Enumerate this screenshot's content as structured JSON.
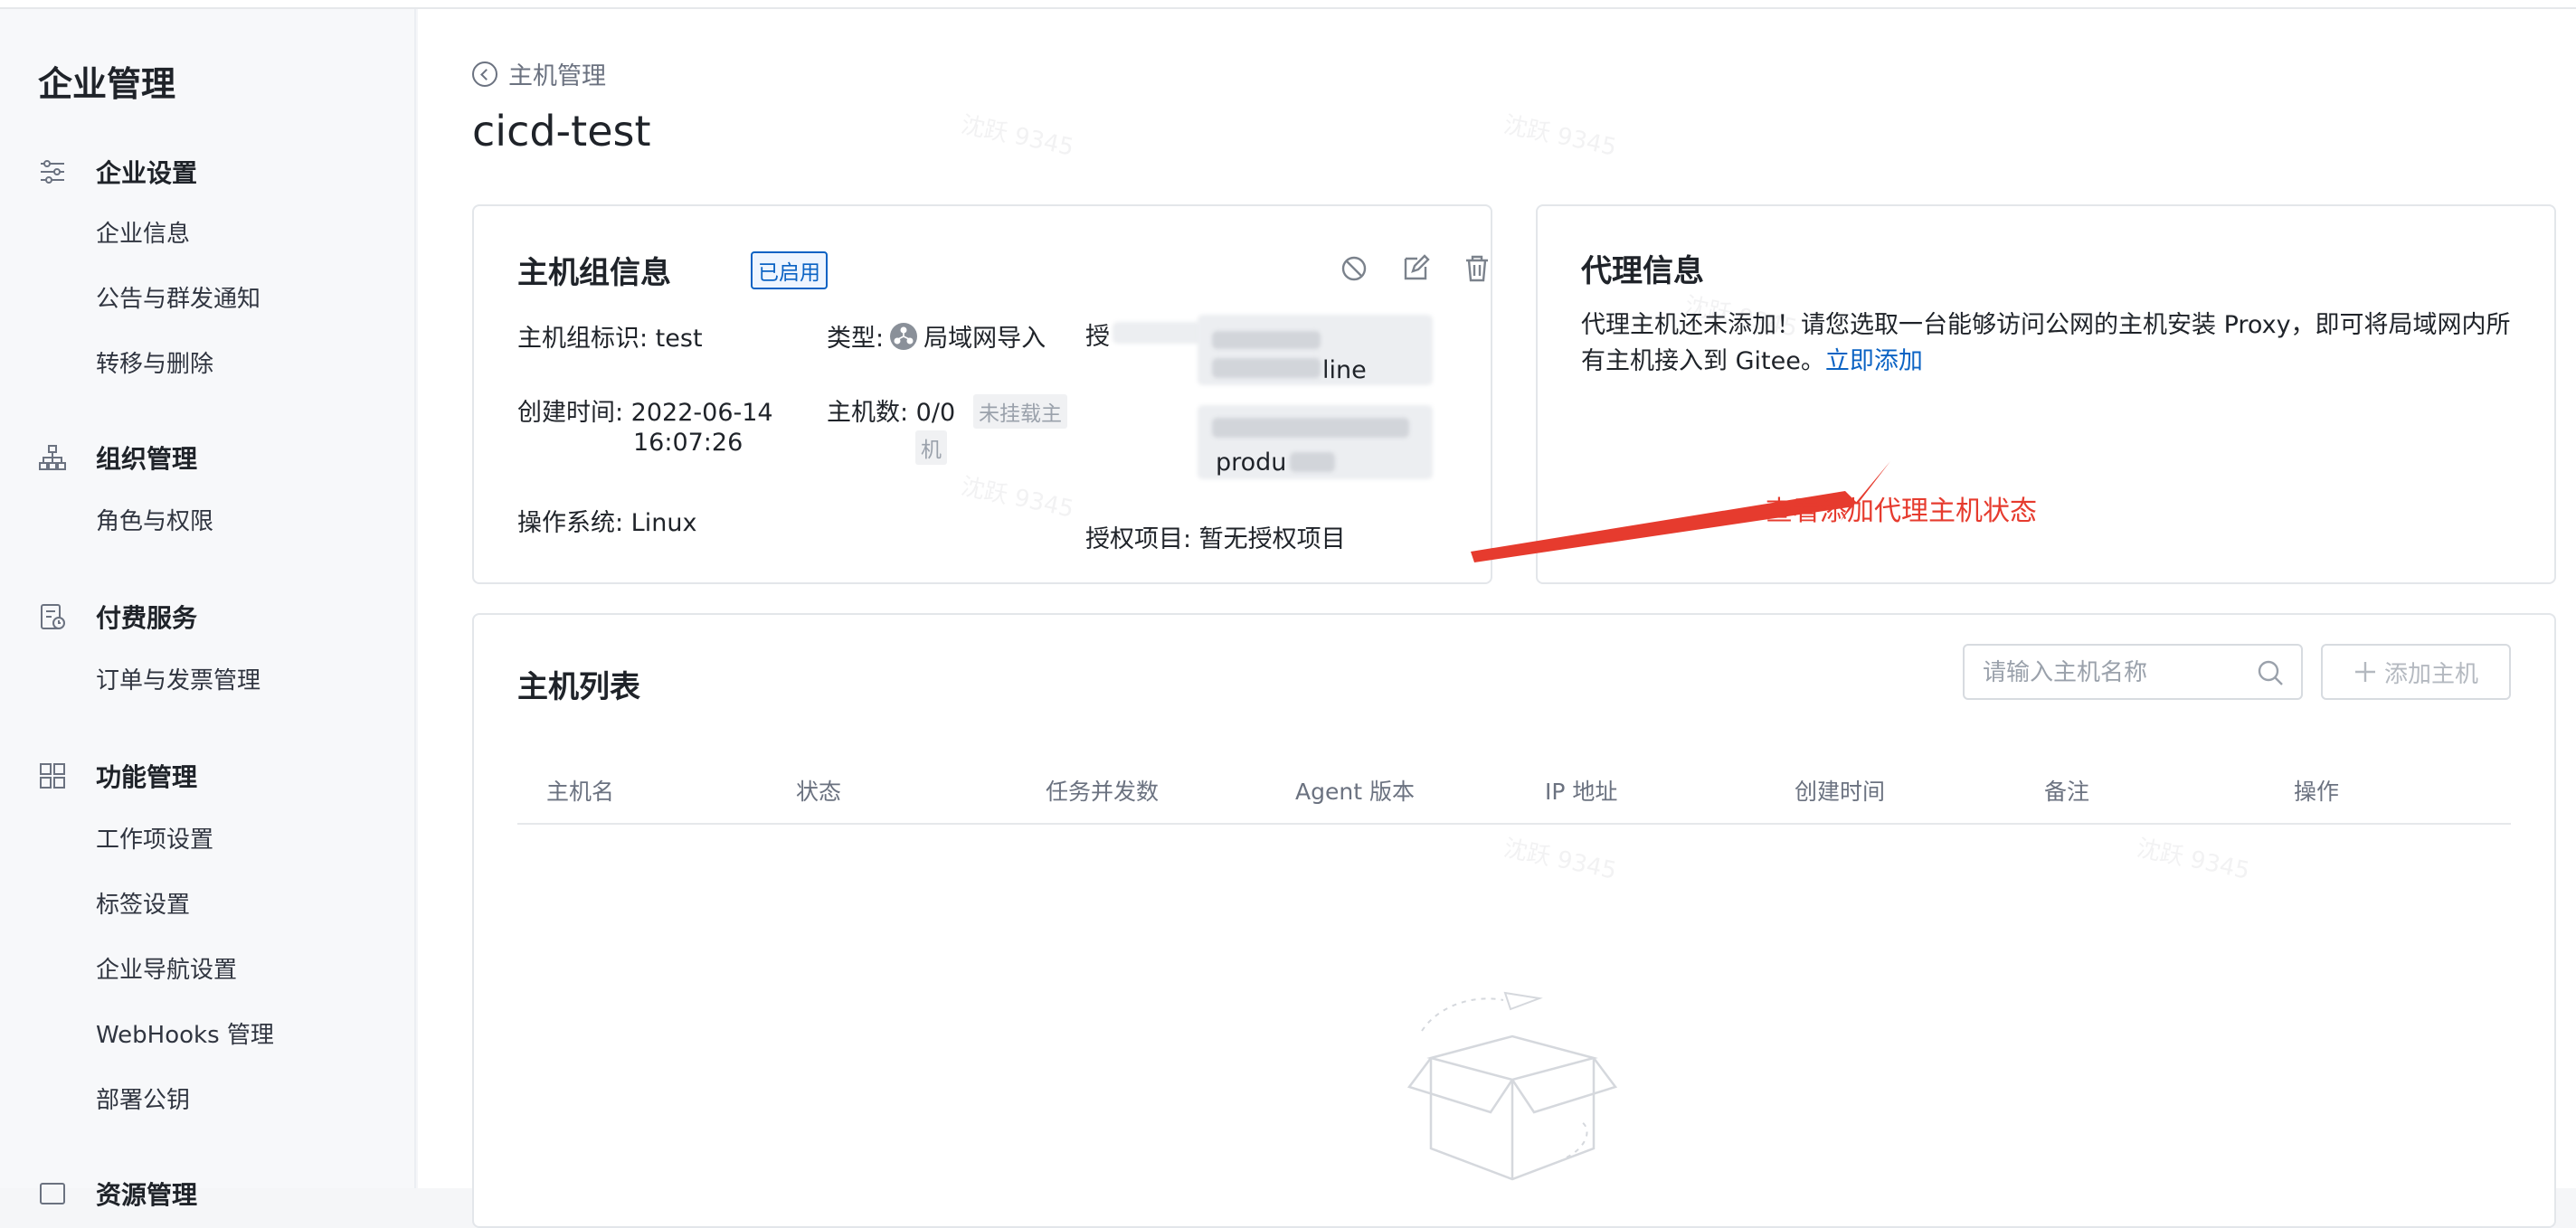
{
  "sidebar": {
    "title": "企业管理",
    "groups": [
      {
        "label": "企业设置",
        "icon": "sliders-icon",
        "items": [
          "企业信息",
          "公告与群发通知",
          "转移与删除"
        ]
      },
      {
        "label": "组织管理",
        "icon": "org-tree-icon",
        "items": [
          "角色与权限"
        ]
      },
      {
        "label": "付费服务",
        "icon": "billing-icon",
        "items": [
          "订单与发票管理"
        ]
      },
      {
        "label": "功能管理",
        "icon": "grid-icon",
        "items": [
          "工作项设置",
          "标签设置",
          "企业导航设置",
          "WebHooks 管理",
          "部署公钥"
        ]
      },
      {
        "label": "资源管理",
        "icon": "resource-icon",
        "items": []
      }
    ]
  },
  "header": {
    "back_label": "主机管理",
    "title": "cicd-test"
  },
  "host_group": {
    "title": "主机组信息",
    "status_badge": "已启用",
    "identifier": "主机组标识: test",
    "created_label": "创建时间: 2022-06-14",
    "created_time": "16:07:26",
    "os": "操作系统: Linux",
    "type_label": "类型:",
    "type_value": "局域网导入",
    "host_count": "主机数: 0/0",
    "unmounted_tag_1": "未挂载主",
    "unmounted_tag_2": "机",
    "auth_label_partial": "授",
    "blur_text_1": "line",
    "blur_text_2": "produ",
    "auth_projects": "授权项目: 暂无授权项目"
  },
  "proxy": {
    "title": "代理信息",
    "message": "代理主机还未添加！请您选取一台能够访问公网的主机安装 Proxy，即可将局域网内所有主机接入到 Gitee。",
    "link": "立即添加"
  },
  "annotation": {
    "text": "查看添加代理主机状态",
    "color": "#e63b2e"
  },
  "host_list": {
    "title": "主机列表",
    "search_placeholder": "请输入主机名称",
    "add_button": "添加主机",
    "columns": [
      "主机名",
      "状态",
      "任务并发数",
      "Agent 版本",
      "IP 地址",
      "创建时间",
      "备注",
      "操作"
    ]
  },
  "watermark": "沈跃 9345",
  "colors": {
    "accent": "#0b63c4",
    "annotation_red": "#e63b2e"
  }
}
